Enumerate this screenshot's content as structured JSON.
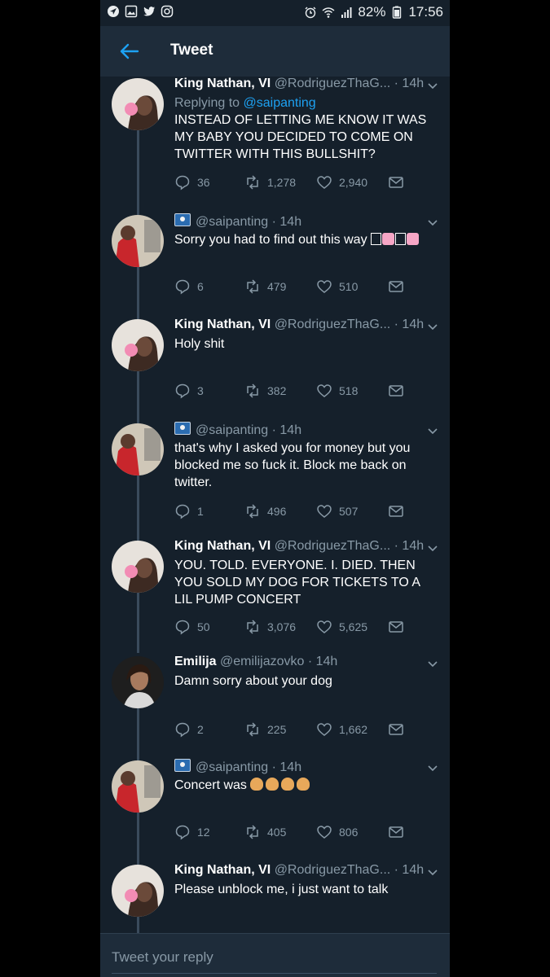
{
  "status": {
    "battery": "82%",
    "time": "17:56",
    "left_icons": [
      "navigation-icon",
      "gallery-icon",
      "twitter-icon",
      "instagram-icon"
    ],
    "right_icons": [
      "alarm-icon",
      "wifi-icon",
      "signal-icon",
      "battery-icon"
    ]
  },
  "header": {
    "title": "Tweet"
  },
  "tweets": [
    {
      "author": "King Nathan, VI",
      "handle": "@RodriguezThaG... · 14h",
      "reply_prefix": "Replying to ",
      "reply_handle": "@saipanting",
      "text": "INSTEAD OF LETTING ME KNOW IT WAS MY BABY YOU DECIDED TO COME ON TWITTER WITH THIS BULLSHIT?",
      "replies": "36",
      "retweets": "1,278",
      "likes": "2,940"
    },
    {
      "author": "",
      "handle": "@saipanting · 14h",
      "text": "Sorry you had to find out this way",
      "replies": "6",
      "retweets": "479",
      "likes": "510"
    },
    {
      "author": "King Nathan, VI",
      "handle": "@RodriguezThaG... · 14h",
      "text": "Holy shit",
      "replies": "3",
      "retweets": "382",
      "likes": "518"
    },
    {
      "author": "",
      "handle": "@saipanting · 14h",
      "text": "that's why I asked you for money but you blocked me so fuck it. Block me back on twitter.",
      "replies": "1",
      "retweets": "496",
      "likes": "507"
    },
    {
      "author": "King Nathan, VI",
      "handle": "@RodriguezThaG... · 14h",
      "text": "YOU. TOLD. EVERYONE. I. DIED. THEN YOU SOLD MY DOG FOR TICKETS TO A LIL PUMP CONCERT",
      "replies": "50",
      "retweets": "3,076",
      "likes": "5,625"
    },
    {
      "author": "Emilija",
      "handle": "@emilijazovko · 14h",
      "text": "Damn sorry about your dog",
      "replies": "2",
      "retweets": "225",
      "likes": "1,662"
    },
    {
      "author": "",
      "handle": "@saipanting · 14h",
      "text": "Concert was",
      "replies": "12",
      "retweets": "405",
      "likes": "806"
    },
    {
      "author": "King Nathan, VI",
      "handle": "@RodriguezThaG... · 14h",
      "text": "Please unblock me, i just want to talk"
    }
  ],
  "reply_bar": {
    "placeholder": "Tweet your reply"
  },
  "colors": {
    "background": "#15202b",
    "header": "#1e2c3a",
    "accent": "#1da1f2",
    "muted": "#8899a6"
  }
}
